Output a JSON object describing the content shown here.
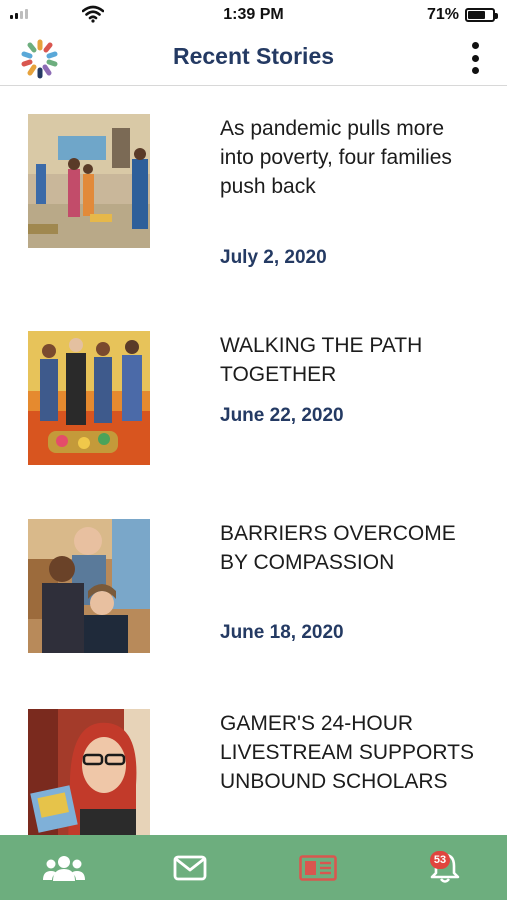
{
  "status_bar": {
    "time": "1:39 PM",
    "battery_percent": "71%",
    "battery_level": 0.71,
    "signal_bars_active": 2,
    "signal_bars_total": 4
  },
  "header": {
    "title": "Recent Stories",
    "logo_icon": "dots-flower-logo-icon",
    "menu_icon": "more-vertical-icon"
  },
  "stories": [
    {
      "title": "As pandemic pulls more into poverty, four families push back",
      "date": "July 2, 2020"
    },
    {
      "title": "WALKING THE PATH TOGETHER",
      "date": "June 22, 2020"
    },
    {
      "title": "BARRIERS OVERCOME BY COMPASSION",
      "date": "June 18, 2020"
    },
    {
      "title": "GAMER'S 24-HOUR LIVESTREAM SUPPORTS UNBOUND SCHOLARS",
      "date": ""
    }
  ],
  "bottom_nav": {
    "items": [
      {
        "icon": "community-icon",
        "active": false
      },
      {
        "icon": "mail-icon",
        "active": false
      },
      {
        "icon": "stories-icon",
        "active": true
      },
      {
        "icon": "notifications-bell-icon",
        "active": false,
        "badge": "53"
      }
    ]
  },
  "colors": {
    "title_navy": "#243a63",
    "nav_green": "#6dae7e",
    "active_red": "#d9564f",
    "badge_red": "#e0453e"
  }
}
